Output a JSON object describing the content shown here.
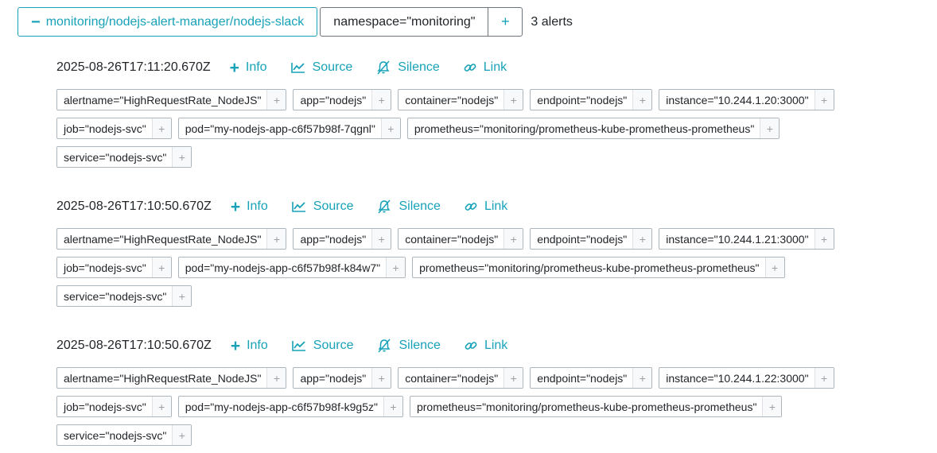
{
  "header": {
    "group_label": "monitoring/nodejs-alert-manager/nodejs-slack",
    "namespace_filter": "namespace=\"monitoring\"",
    "add_label": "+",
    "alert_count": "3 alerts"
  },
  "colors": {
    "accent": "#17a2b8",
    "text": "#212529",
    "border": "#adb5bd"
  },
  "actions": {
    "info": "Info",
    "source": "Source",
    "silence": "Silence",
    "link": "Link"
  },
  "alerts": [
    {
      "timestamp": "2025-08-26T17:11:20.670Z",
      "labels": [
        "alertname=\"HighRequestRate_NodeJS\"",
        "app=\"nodejs\"",
        "container=\"nodejs\"",
        "endpoint=\"nodejs\"",
        "instance=\"10.244.1.20:3000\"",
        "job=\"nodejs-svc\"",
        "pod=\"my-nodejs-app-c6f57b98f-7qgnl\"",
        "prometheus=\"monitoring/prometheus-kube-prometheus-prometheus\"",
        "service=\"nodejs-svc\""
      ]
    },
    {
      "timestamp": "2025-08-26T17:10:50.670Z",
      "labels": [
        "alertname=\"HighRequestRate_NodeJS\"",
        "app=\"nodejs\"",
        "container=\"nodejs\"",
        "endpoint=\"nodejs\"",
        "instance=\"10.244.1.21:3000\"",
        "job=\"nodejs-svc\"",
        "pod=\"my-nodejs-app-c6f57b98f-k84w7\"",
        "prometheus=\"monitoring/prometheus-kube-prometheus-prometheus\"",
        "service=\"nodejs-svc\""
      ]
    },
    {
      "timestamp": "2025-08-26T17:10:50.670Z",
      "labels": [
        "alertname=\"HighRequestRate_NodeJS\"",
        "app=\"nodejs\"",
        "container=\"nodejs\"",
        "endpoint=\"nodejs\"",
        "instance=\"10.244.1.22:3000\"",
        "job=\"nodejs-svc\"",
        "pod=\"my-nodejs-app-c6f57b98f-k9g5z\"",
        "prometheus=\"monitoring/prometheus-kube-prometheus-prometheus\"",
        "service=\"nodejs-svc\""
      ]
    }
  ]
}
